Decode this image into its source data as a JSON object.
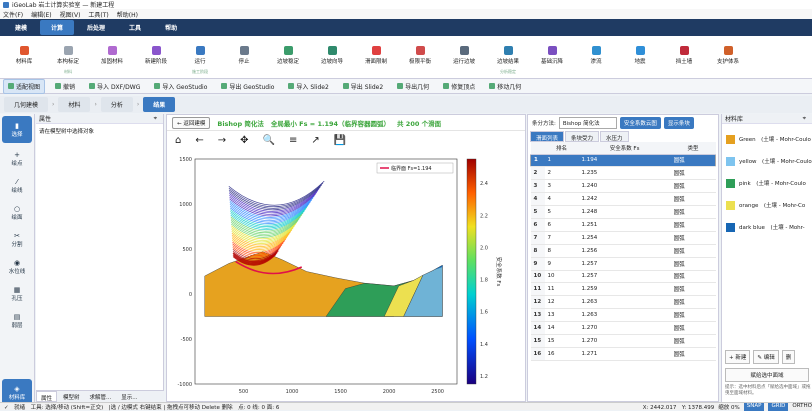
{
  "app": {
    "title": "iGeoLab 岩土计算实验室 — 新建工程"
  },
  "menu": [
    "文件(F)",
    "编辑(E)",
    "视图(V)",
    "工具(T)",
    "帮助(H)"
  ],
  "tabs": [
    {
      "label": "建模"
    },
    {
      "label": "计算",
      "active": true
    },
    {
      "label": "后处理"
    },
    {
      "label": "工具"
    },
    {
      "label": "帮助"
    }
  ],
  "ribbon": [
    {
      "label": "材料库",
      "color": "#e0562e"
    },
    {
      "label": "本构标定",
      "color": "#9aa4b0",
      "sub": "材料"
    },
    {
      "label": "加固材料",
      "color": "#b06ad0"
    },
    {
      "label": "新建阶段",
      "color": "#8a55cc"
    },
    {
      "label": "运行",
      "color": "#3a79c1",
      "sub": "施工阶段"
    },
    {
      "label": "停止",
      "color": "#6b7a8c"
    },
    {
      "label": "边坡稳定",
      "color": "#3b9c6b"
    },
    {
      "label": "边坡向导",
      "color": "#2f8a6c"
    },
    {
      "label": "滑面限制",
      "color": "#e04040"
    },
    {
      "label": "极限平衡",
      "color": "#d04b4b"
    },
    {
      "label": "运行边坡",
      "color": "#5a6a7c"
    },
    {
      "label": "边坡结果",
      "color": "#2f7fb0",
      "sub": "分析稳定"
    },
    {
      "label": "基础沉降",
      "color": "#7a4fc0"
    },
    {
      "label": "渗流",
      "color": "#3090d0"
    },
    {
      "label": "地震",
      "color": "#2f8fd8"
    },
    {
      "label": "挡土墙",
      "color": "#c02a3a"
    },
    {
      "label": "支护体系",
      "color": "#d0602a"
    }
  ],
  "toolbar2": [
    {
      "label": "适配视图",
      "active": true
    },
    {
      "label": "撤销"
    },
    {
      "label": "导入 DXF/DWG"
    },
    {
      "label": "导入 GeoStudio"
    },
    {
      "label": "导出 GeoStudio"
    },
    {
      "label": "导入 Slide2"
    },
    {
      "label": "导出 Slide2"
    },
    {
      "label": "导出几何"
    },
    {
      "label": "修复顶点"
    },
    {
      "label": "移动几何"
    }
  ],
  "crumbs": [
    {
      "label": "几何建模"
    },
    {
      "label": "材料"
    },
    {
      "label": "分析"
    },
    {
      "label": "结果",
      "active": true
    }
  ],
  "leftnav": [
    {
      "label": "选择",
      "icon": "cursor-icon",
      "glyph": "▮",
      "active": true
    },
    {
      "label": "绘点",
      "icon": "point-icon",
      "glyph": "+"
    },
    {
      "label": "绘线",
      "icon": "line-icon",
      "glyph": "⁄"
    },
    {
      "label": "绘面",
      "icon": "polygon-icon",
      "glyph": "○"
    },
    {
      "label": "分割",
      "icon": "scissors-icon",
      "glyph": "✂"
    },
    {
      "label": "水位线",
      "icon": "water-icon",
      "glyph": "◉"
    },
    {
      "label": "孔压",
      "icon": "pressure-icon",
      "glyph": "▦"
    },
    {
      "label": "弱层",
      "icon": "weak-layer-icon",
      "glyph": "▤"
    },
    {
      "label": "材料库",
      "icon": "material-icon",
      "glyph": "◈",
      "active": true
    }
  ],
  "properties": {
    "header": "属性",
    "hint": "请在模型树中选择对象",
    "tabs": [
      "属性",
      "模型树",
      "求解管...",
      "显示..."
    ]
  },
  "result": {
    "back": "← 返回建模",
    "method": "Bishop 简化法",
    "min_fs": "全局最小 Fs = 1.194（临界容器圆弧）",
    "count": "共 200 个滑面"
  },
  "plot_tools": [
    "⌂",
    "←",
    "→",
    "✥",
    "🔍",
    "≡",
    "↗",
    "💾"
  ],
  "chart_data": {
    "type": "scatter",
    "legend": "临界面 Fs=1.194",
    "ylim": [
      -1000,
      1500
    ],
    "xlim": [
      0,
      2700
    ],
    "xticks": [
      500,
      1000,
      1500,
      2000,
      2500
    ],
    "yticks": [
      1500,
      1000,
      500,
      0,
      -500,
      -1000
    ],
    "colorbar": {
      "label": "安全系数 Fs",
      "range": [
        1.15,
        2.55
      ],
      "ticks": [
        "2.4",
        "2.2",
        "2.0",
        "1.8",
        "1.6",
        "1.4",
        "1.2"
      ]
    }
  },
  "right": {
    "method_label": "条分方法:",
    "method_value": "Bishop 简化法",
    "btn1": "安全系数云图",
    "btn2": "显示条块",
    "tabs": [
      {
        "label": "滑面列表",
        "active": true
      },
      {
        "label": "条块受力"
      },
      {
        "label": "水压力"
      }
    ],
    "columns": [
      "排名",
      "安全系数 Fs",
      "类型"
    ],
    "rows": [
      [
        "1",
        "1",
        "1.194",
        "圆弧"
      ],
      [
        "2",
        "2",
        "1.235",
        "圆弧"
      ],
      [
        "3",
        "3",
        "1.240",
        "圆弧"
      ],
      [
        "4",
        "4",
        "1.242",
        "圆弧"
      ],
      [
        "5",
        "5",
        "1.248",
        "圆弧"
      ],
      [
        "6",
        "6",
        "1.251",
        "圆弧"
      ],
      [
        "7",
        "7",
        "1.254",
        "圆弧"
      ],
      [
        "8",
        "8",
        "1.256",
        "圆弧"
      ],
      [
        "9",
        "9",
        "1.257",
        "圆弧"
      ],
      [
        "10",
        "10",
        "1.257",
        "圆弧"
      ],
      [
        "11",
        "11",
        "1.259",
        "圆弧"
      ],
      [
        "12",
        "12",
        "1.263",
        "圆弧"
      ],
      [
        "13",
        "13",
        "1.263",
        "圆弧"
      ],
      [
        "14",
        "14",
        "1.270",
        "圆弧"
      ],
      [
        "15",
        "15",
        "1.270",
        "圆弧"
      ],
      [
        "16",
        "16",
        "1.271",
        "圆弧"
      ]
    ]
  },
  "matlib": {
    "header": "材料库",
    "items": [
      {
        "name": "Green　(土壤 - Mohr-Coulo",
        "color": "#e5a020"
      },
      {
        "name": "yellow　(土壤 - Mohr-Coulo",
        "color": "#7ec4ef"
      },
      {
        "name": "pink　(土壤 - Mohr-Coulo",
        "color": "#2e9e58"
      },
      {
        "name": "orange　(土壤 - Mohr-Co",
        "color": "#ece050"
      },
      {
        "name": "dark blue　(土壤 - Mohr-",
        "color": "#1766b4"
      }
    ],
    "new": "+ 新建",
    "edit": "✎ 编辑",
    "del": "删",
    "assign": "赋给选中面域",
    "tip": "提示：选中材料后点「赋给选中面域」或拖曳至面域材料。"
  },
  "status": {
    "left": "✓　就绪　工具: 选择/移动 (Shift=正交)　|选 / 边模式 右键结束 | 拖拽点可移动 Delete 删除　点: 0 线: 0 面: 6",
    "coords": "X: 2442.017　Y: 1378.499",
    "zoom": "缩放 0%",
    "snap": "SNAP",
    "grid": "GRID",
    "ortho": "ORTHO"
  }
}
